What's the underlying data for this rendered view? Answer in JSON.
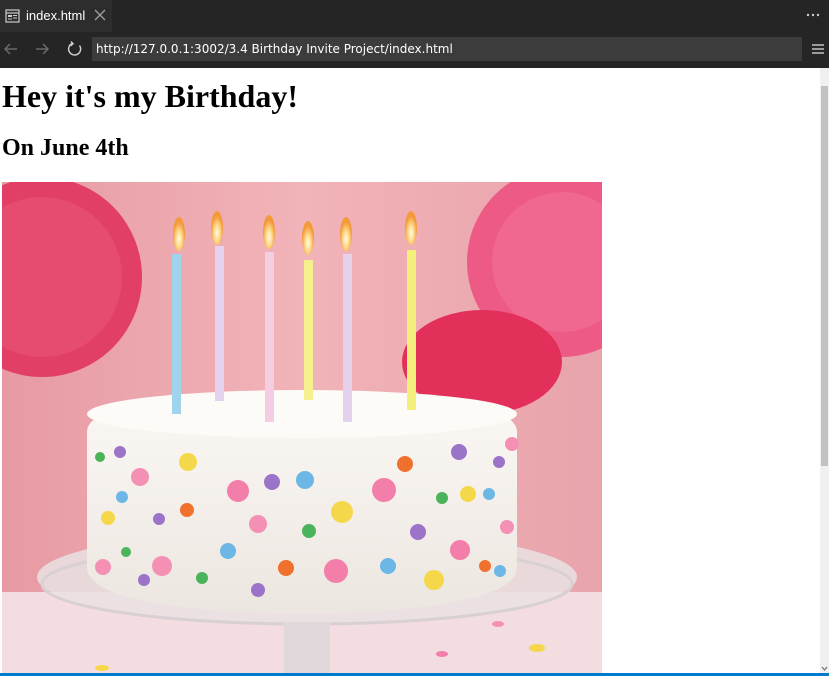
{
  "tab": {
    "title": "index.html",
    "icon": "preview-icon"
  },
  "toolbar": {
    "back_icon": "arrow-left-icon",
    "forward_icon": "arrow-right-icon",
    "reload_icon": "reload-icon",
    "url": "http://127.0.0.1:3002/3.4 Birthday Invite Project/index.html",
    "menu_icon": "hamburger-menu-icon",
    "more_icon": "more-actions-icon"
  },
  "page": {
    "heading": "Hey it's my Birthday!",
    "subheading": "On June 4th",
    "image_subject": "birthday-cake-with-candles"
  },
  "colors": {
    "chrome_bg": "#252526",
    "url_bg": "#3c3c3c",
    "status_accent": "#007acc"
  }
}
